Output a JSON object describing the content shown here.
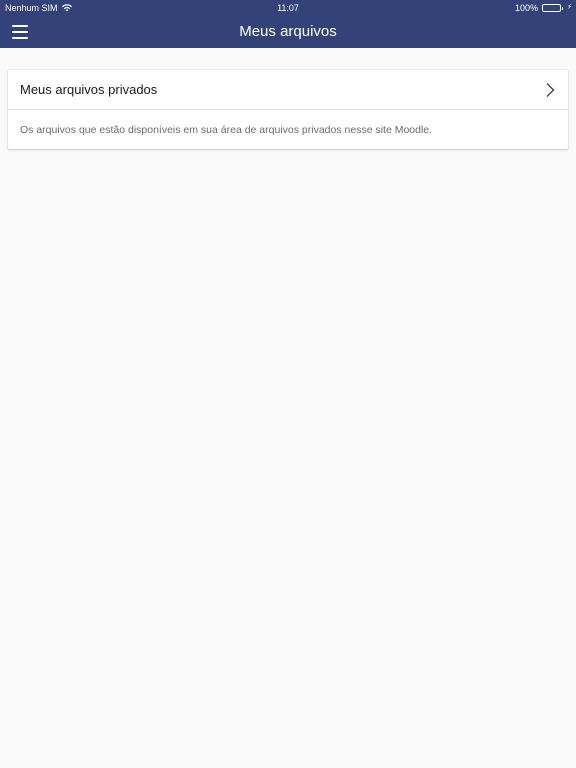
{
  "status_bar": {
    "carrier": "Nenhum SIM",
    "time": "11:07",
    "battery": "100%",
    "battery_level": 1.0
  },
  "header": {
    "title": "Meus arquivos",
    "menu_icon": "hamburger-menu-icon"
  },
  "card": {
    "item_label": "Meus arquivos privados",
    "item_icon": "chevron-right-icon",
    "description": "Os arquivos que estão disponíveis em sua área de arquivos privados nesse site Moodle."
  },
  "colors": {
    "header_bg": "#33437a",
    "page_bg": "#fafafa",
    "battery_fill": "#4cd964"
  }
}
